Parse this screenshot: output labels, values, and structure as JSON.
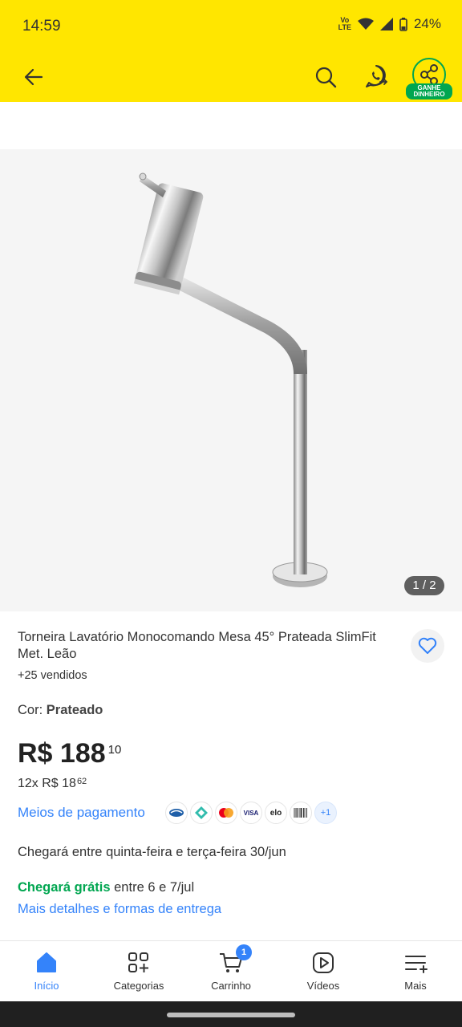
{
  "status_bar": {
    "time": "14:59",
    "volte_top": "Vo",
    "volte_bottom": "LTE",
    "battery": "24%"
  },
  "app_bar": {
    "share_badge_line1": "GANHE",
    "share_badge_line2": "DINHEIRO"
  },
  "gallery": {
    "counter": "1 / 2"
  },
  "product": {
    "title": "Torneira Lavatório Monocomando Mesa 45° Prateada SlimFit Met. Leão",
    "sold": "+25 vendidos",
    "color_label": "Cor: ",
    "color_value": "Prateado",
    "price_main": "R$ 188",
    "price_cents": "10",
    "installments_main": "12x R$ 18",
    "installments_cents": "62"
  },
  "payment": {
    "link": "Meios de pagamento",
    "more": "+1",
    "icons": [
      "caixa-icon",
      "pix-icon",
      "mastercard-icon",
      "visa-icon",
      "elo-icon",
      "boleto-icon"
    ],
    "visa": "VISA",
    "elo": "elo"
  },
  "delivery": {
    "estimate": "Chegará entre quinta-feira e terça-feira 30/jun",
    "free_strong": "Chegará grátis",
    "free_rest": " entre 6 e 7/jul",
    "details_link": "Mais detalhes e formas de entrega"
  },
  "bottom_nav": {
    "items": [
      {
        "label": "Início"
      },
      {
        "label": "Categorias"
      },
      {
        "label": "Carrinho"
      },
      {
        "label": "Vídeos"
      },
      {
        "label": "Mais"
      }
    ],
    "cart_count": "1"
  },
  "colors": {
    "brand_yellow": "#ffe600",
    "link_blue": "#3483fa",
    "green": "#00a650"
  }
}
